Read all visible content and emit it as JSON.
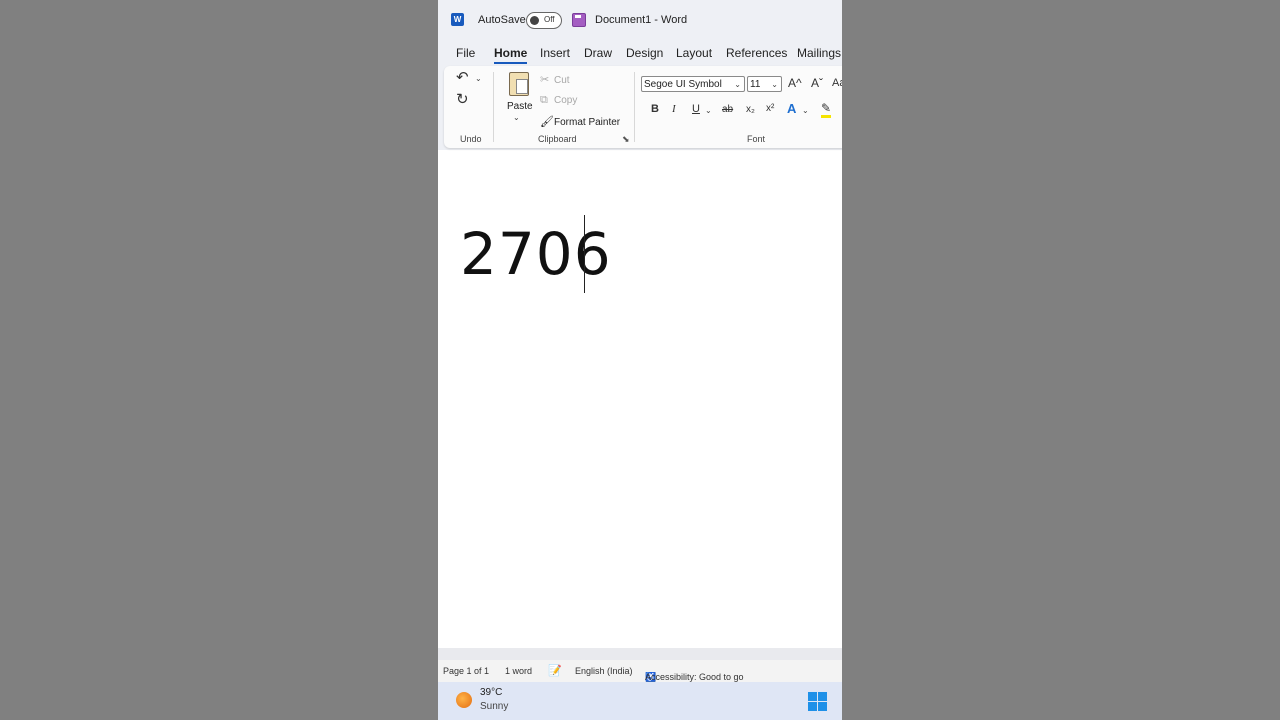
{
  "titlebar": {
    "app_logo": "W",
    "autosave_label": "AutoSave",
    "autosave_state": "Off",
    "document_title": "Document1  -  Word"
  },
  "tabs": [
    "File",
    "Home",
    "Insert",
    "Draw",
    "Design",
    "Layout",
    "References",
    "Mailings"
  ],
  "active_tab": "Home",
  "ribbon": {
    "undo_group_label": "Undo",
    "clipboard": {
      "paste_label": "Paste",
      "cut_label": "Cut",
      "copy_label": "Copy",
      "format_painter_label": "Format Painter",
      "group_label": "Clipboard"
    },
    "font": {
      "font_name": "Segoe UI Symbol",
      "font_size": "11",
      "group_label": "Font",
      "bold": "B",
      "italic": "I",
      "underline": "U",
      "strikethrough": "ab",
      "subscript": "x₂",
      "superscript": "x²",
      "grow_font": "A^",
      "shrink_font": "Aˇ",
      "change_case": "Aa",
      "text_effects": "A"
    }
  },
  "document": {
    "content": "2706"
  },
  "status_bar": {
    "page": "Page 1 of 1",
    "words": "1 word",
    "language": "English (India)",
    "accessibility": "Accessibility: Good to go"
  },
  "taskbar": {
    "temperature": "39°C",
    "condition": "Sunny"
  },
  "colors": {
    "accent": "#185abd",
    "ribbon_bg": "#eef0f5",
    "backdrop": "#808080"
  }
}
